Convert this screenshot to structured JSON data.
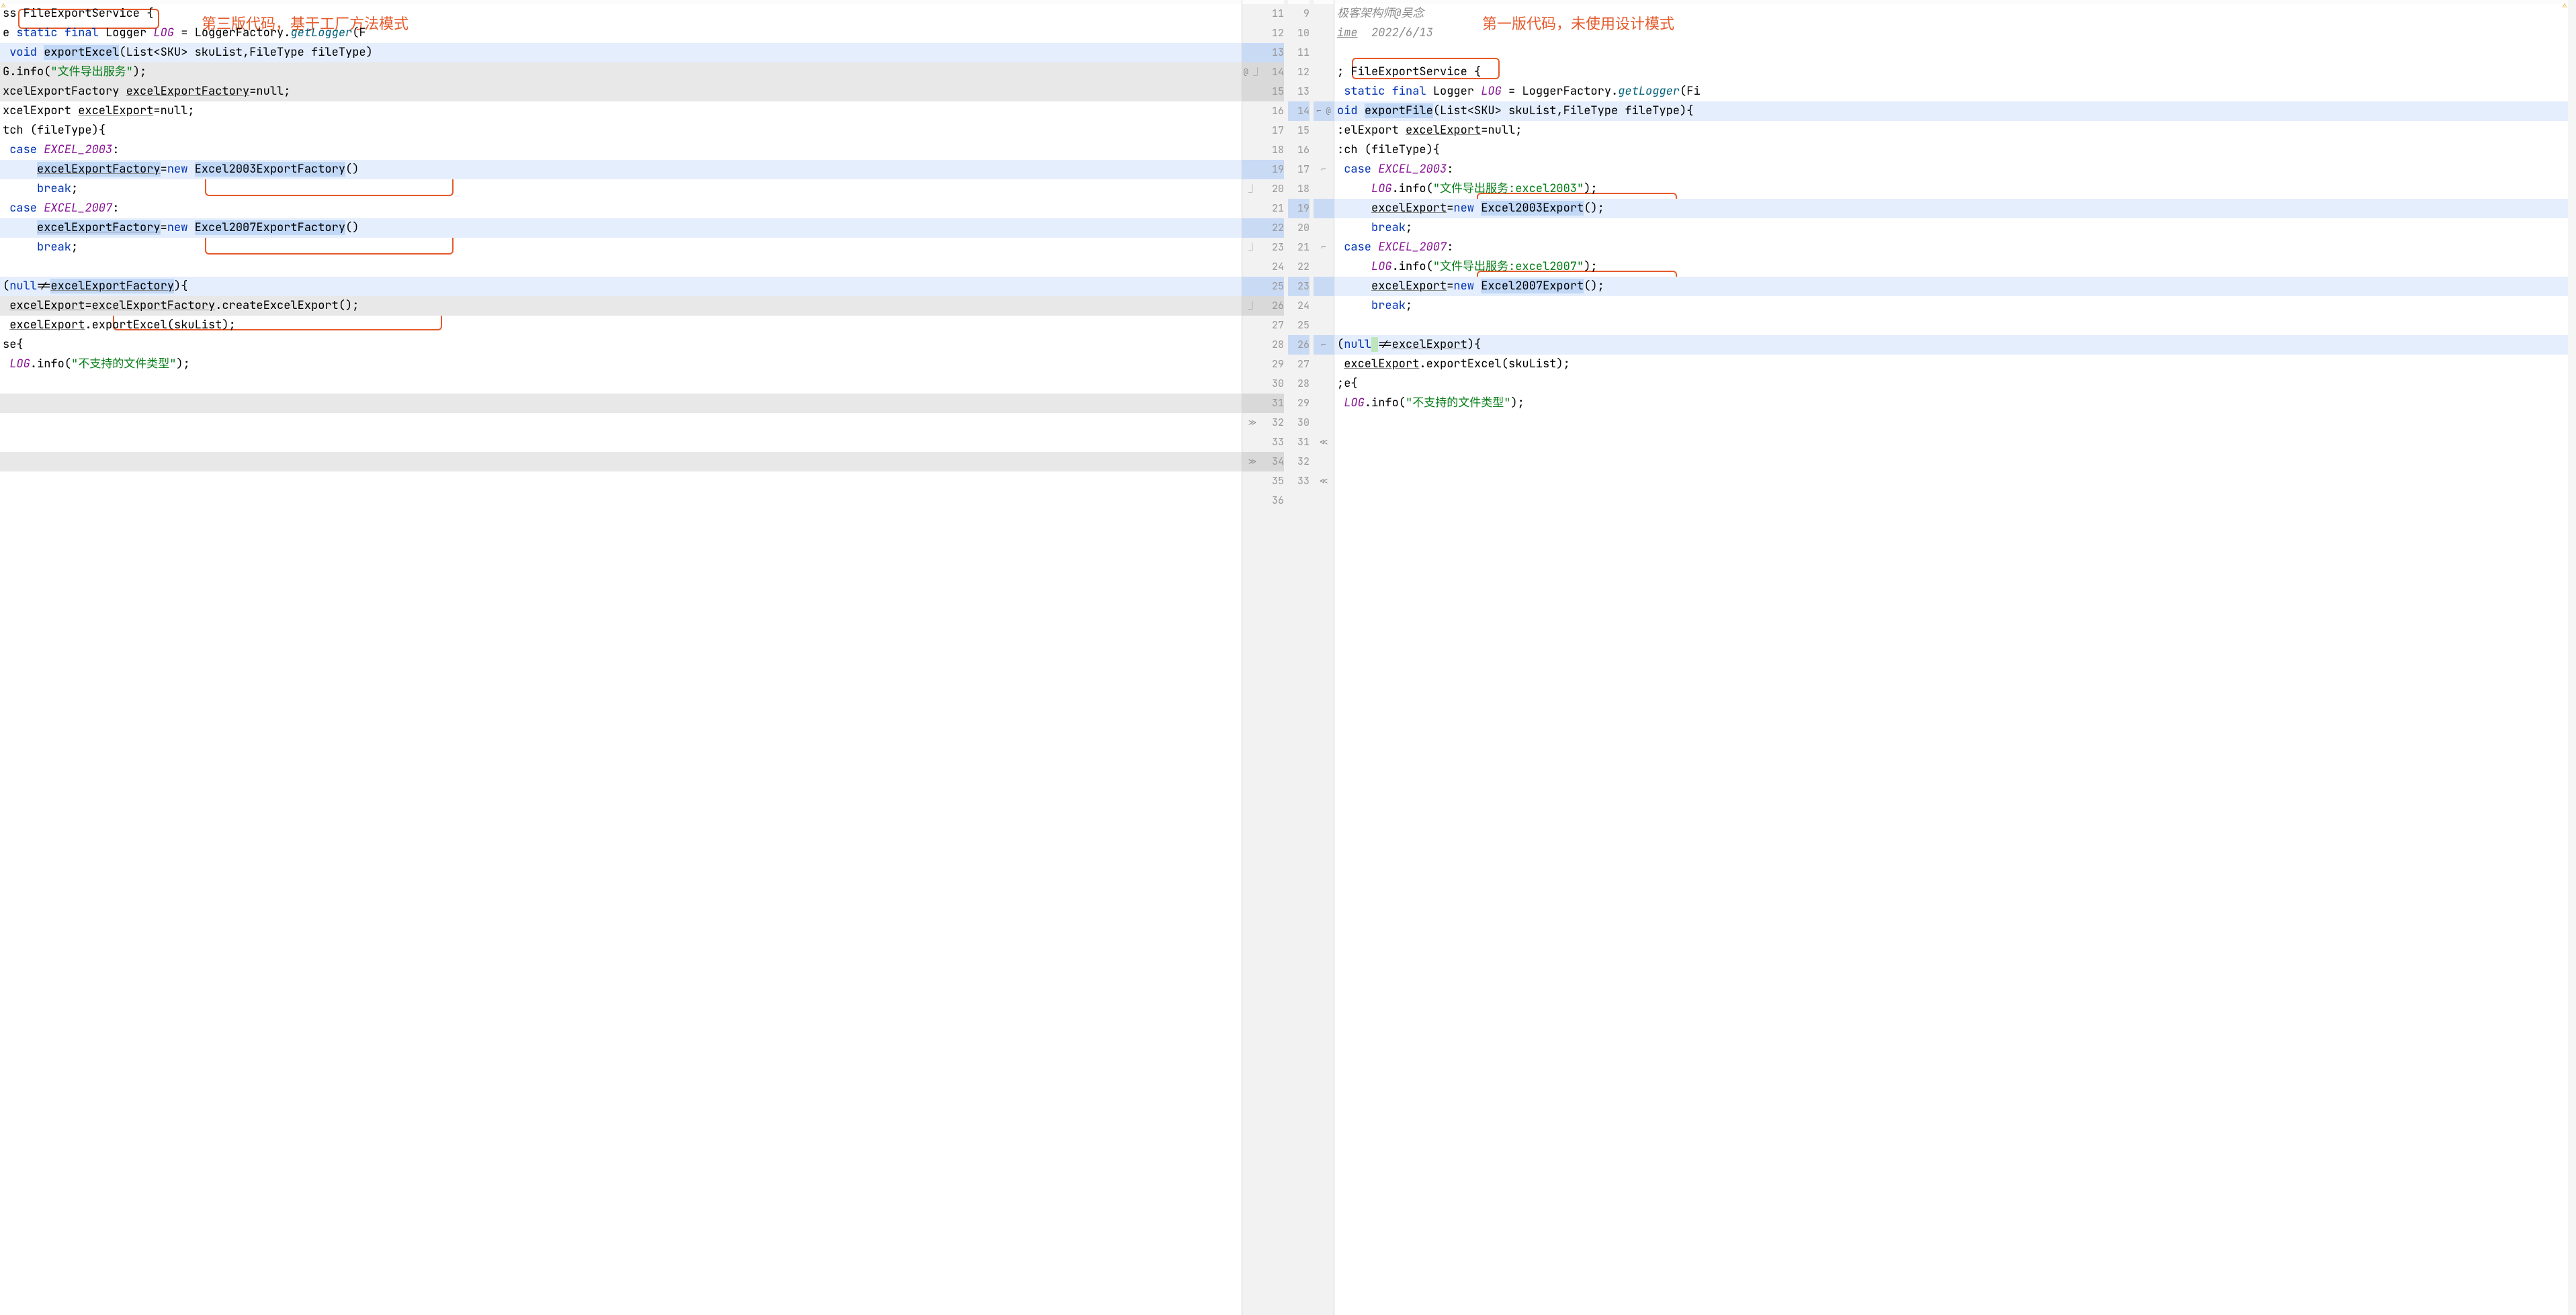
{
  "annotations": {
    "left_title": "第三版代码，基于工厂方法模式",
    "right_title": "第一版代码，未使用设计模式"
  },
  "gutter": {
    "left": [
      "",
      "",
      "",
      "@ ⏌",
      "",
      "",
      "",
      "",
      "",
      "⏌",
      "",
      "",
      "⏌",
      "",
      "",
      "⏌",
      "",
      "",
      "",
      "",
      "",
      "≫",
      "",
      "≫",
      "",
      ""
    ],
    "leftNums": [
      "11",
      "12",
      "13",
      "14",
      "15",
      "16",
      "17",
      "18",
      "19",
      "20",
      "21",
      "22",
      "23",
      "24",
      "25",
      "26",
      "27",
      "28",
      "29",
      "30",
      "31",
      "32",
      "33",
      "34",
      "35",
      "36"
    ],
    "rightNums": [
      "9",
      "10",
      "11",
      "12",
      "13",
      "14",
      "15",
      "16",
      "17",
      "18",
      "19",
      "20",
      "21",
      "22",
      "23",
      "24",
      "25",
      "26",
      "27",
      "28",
      "29",
      "30",
      "31",
      "32",
      "33",
      ""
    ],
    "right": [
      "",
      "",
      "",
      "",
      "",
      "⌐ @",
      "",
      "",
      "⌐",
      "",
      "",
      "",
      "⌐",
      "",
      "",
      "",
      "",
      "⌐",
      "",
      "",
      "",
      "",
      "≪",
      "",
      "≪",
      ""
    ]
  },
  "left": {
    "l1": {
      "pre": "ss ",
      "cls": "FileExportService",
      "post": " {"
    },
    "l2": {
      "a": "e ",
      "kw": "static final ",
      "type": "Logger ",
      "fld": "LOG",
      "eq": " = LoggerFactory.",
      "m": "getLogger",
      "post": "(F"
    },
    "l3": {
      "kw": " void ",
      "m": "exportExcel",
      "sig": "(List<SKU> skuList,FileType fileType)"
    },
    "l4": {
      "pre": "G",
      "m": ".info(",
      "str": "\"文件导出服务\"",
      "post": ");"
    },
    "l5": {
      "t": "xcelExportFactory ",
      "v": "excelExportFactory",
      "post": "=null;"
    },
    "l6": {
      "t": "xcelExport ",
      "v": "excelExport",
      "post": "=null;"
    },
    "l7": {
      "t": "tch (fileType){"
    },
    "l8": {
      "kw": " case ",
      "c": "EXCEL_2003",
      "post": ":"
    },
    "l9": {
      "indent": "     ",
      "v": "excelExportFactory",
      "eq": "=",
      "kw": "new ",
      "cls": "Excel2003ExportFactory",
      "post": "()"
    },
    "l10": {
      "indent": "     ",
      "kw": "break",
      "post": ";"
    },
    "l11": {
      "kw": " case ",
      "c": "EXCEL_2007",
      "post": ":"
    },
    "l12": {
      "indent": "     ",
      "v": "excelExportFactory",
      "eq": "=",
      "kw": "new ",
      "cls": "Excel2007ExportFactory",
      "post": "()"
    },
    "l13": {
      "indent": "     ",
      "kw": "break",
      "post": ";"
    },
    "l14": {
      "t": ""
    },
    "l15": {
      "pre": "(",
      "kw": "null",
      "ne": "!=",
      "v": "excelExportFactory",
      "post": "){"
    },
    "l16": {
      "indent": " ",
      "v": "excelExport",
      "eq": "=",
      "v2": "excelExportFactory",
      "m": ".createExcelExport();"
    },
    "l17": {
      "indent": " ",
      "v": "excelExport",
      "m": ".exportExcel(skuList);"
    },
    "l18": {
      "t": "se{"
    },
    "l19": {
      "indent": " ",
      "fld": "LOG",
      "m": ".info(",
      "str": "\"不支持的文件类型\"",
      "post": ");"
    }
  },
  "right": {
    "r1": {
      "cmt": "极客架构师@吴念"
    },
    "r2": {
      "a": "ime",
      "date": "  2022/6/13"
    },
    "r3": {
      "t": ""
    },
    "r4": {
      "pre": "; ",
      "cls": "FileExportService",
      "post": " {"
    },
    "r5": {
      "kw": " static final ",
      "type": "Logger ",
      "fld": "LOG",
      "eq": " = LoggerFactory.",
      "m": "getLogger",
      "post": "(Fi"
    },
    "r6": {
      "kw": "oid ",
      "m": "exportFile",
      "sig": "(List<SKU> skuList,FileType fileType){"
    },
    "r7": {
      "t": ":elExport ",
      "v": "excelExport",
      "post": "=null;"
    },
    "r8": {
      "t": ":ch (fileType){"
    },
    "r9": {
      "kw": " case ",
      "c": "EXCEL_2003",
      "post": ":"
    },
    "r10": {
      "indent": "     ",
      "fld": "LOG",
      "m": ".info(",
      "str": "\"文件导出服务:excel2003\"",
      "post": ");"
    },
    "r11": {
      "indent": "     ",
      "v": "excelExport",
      "eq": "=",
      "kw": "new ",
      "cls": "Excel2003Export",
      "post": "();"
    },
    "r12": {
      "indent": "     ",
      "kw": "break",
      "post": ";"
    },
    "r13": {
      "kw": " case ",
      "c": "EXCEL_2007",
      "post": ":"
    },
    "r14": {
      "indent": "     ",
      "fld": "LOG",
      "m": ".info(",
      "str": "\"文件导出服务:excel2007\"",
      "post": ");"
    },
    "r15": {
      "indent": "     ",
      "v": "excelExport",
      "eq": "=",
      "kw": "new ",
      "cls": "Excel2007Export",
      "post": "();"
    },
    "r16": {
      "indent": "     ",
      "kw": "break",
      "post": ";"
    },
    "r17": {
      "t": ""
    },
    "r18": {
      "pre": "(",
      "kw": "null",
      "sp": " ",
      "ne": "!=",
      "v": "excelExport",
      "post": "){"
    },
    "r19": {
      "indent": " ",
      "v": "excelExport",
      "m": ".exportExcel(skuList);"
    },
    "r20": {
      "t": ";e{"
    },
    "r21": {
      "indent": " ",
      "fld": "LOG",
      "m": ".info(",
      "str": "\"不支持的文件类型\"",
      "post": ");"
    }
  }
}
